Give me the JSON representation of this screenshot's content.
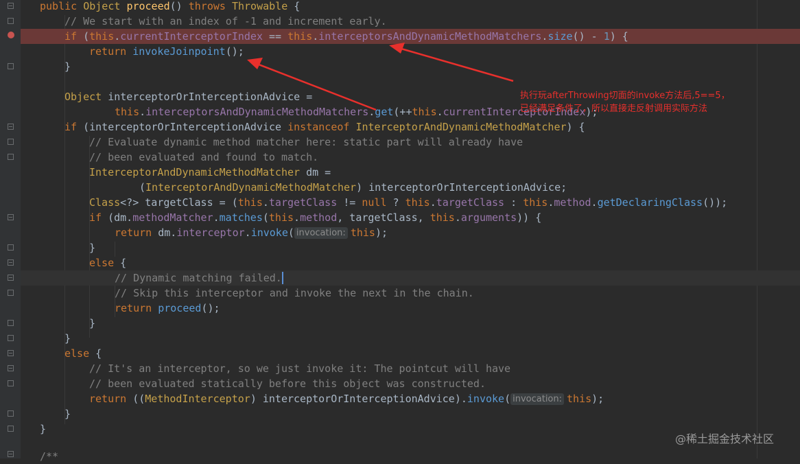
{
  "editor": {
    "lines": {
      "l1_kw1": "public ",
      "l1_type": "Object ",
      "l1_method": "proceed",
      "l1_paren": "() ",
      "l1_throws": "throws ",
      "l1_exc": "Throwable",
      "l1_brace": " {",
      "l2": "// We start with an index of -1 and increment early.",
      "l3_if": "if ",
      "l3_p1": "(",
      "l3_this1": "this",
      "l3_dot1": ".",
      "l3_f1": "currentInterceptorIndex",
      "l3_eq": " == ",
      "l3_this2": "this",
      "l3_dot2": ".",
      "l3_f2": "interceptorsAndDynamicMethodMatchers",
      "l3_dot3": ".",
      "l3_size": "size",
      "l3_rest1": "() - ",
      "l3_one": "1",
      "l3_rest2": ") {",
      "l4_ret": "return ",
      "l4_call": "invokeJoinpoint",
      "l4_rest": "();",
      "l5": "}",
      "l7_type": "Object ",
      "l7_rest": "interceptorOrInterceptionAdvice =",
      "l8_this1": "this",
      "l8_dot": ".",
      "l8_field": "interceptorsAndDynamicMethodMatchers",
      "l8_dot2": ".",
      "l8_get": "get",
      "l8_p": "(++",
      "l8_this2": "this",
      "l8_dot3": ".",
      "l8_f2": "currentInterceptorIndex",
      "l8_end": ");",
      "l9_if": "if ",
      "l9_mid": "(interceptorOrInterceptionAdvice ",
      "l9_inst": "instanceof ",
      "l9_type": "InterceptorAndDynamicMethodMatcher",
      "l9_end": ") {",
      "l10": "// Evaluate dynamic method matcher here: static part will already have",
      "l11": "// been evaluated and found to match.",
      "l12_type": "InterceptorAndDynamicMethodMatcher",
      "l12_rest": " dm =",
      "l13_p": "(",
      "l13_type": "InterceptorAndDynamicMethodMatcher",
      "l13_rest": ") interceptorOrInterceptionAdvice;",
      "l14_type": "Class",
      "l14_a": "<?> targetClass = (",
      "l14_this1": "this",
      "l14_d1": ".",
      "l14_f1": "targetClass",
      "l14_ne": " != ",
      "l14_null": "null",
      "l14_q": " ? ",
      "l14_this2": "this",
      "l14_d2": ".",
      "l14_f2": "targetClass",
      "l14_c": " : ",
      "l14_this3": "this",
      "l14_d3": ".",
      "l14_f3": "method",
      "l14_d4": ".",
      "l14_m": "getDeclaringClass",
      "l14_end": "());",
      "l15_if": "if ",
      "l15_a": "(dm.",
      "l15_f1": "methodMatcher",
      "l15_d1": ".",
      "l15_m": "matches",
      "l15_b": "(",
      "l15_this1": "this",
      "l15_d2": ".",
      "l15_f2": "method",
      "l15_c": ", targetClass, ",
      "l15_this2": "this",
      "l15_d3": ".",
      "l15_f3": "arguments",
      "l15_end": ")) {",
      "l16_ret": "return ",
      "l16_a": "dm.",
      "l16_f": "interceptor",
      "l16_d": ".",
      "l16_m": "invoke",
      "l16_b": "(",
      "l16_hint": "invocation:",
      "l16_this": "this",
      "l16_end": ");",
      "l17": "}",
      "l18_else": "else ",
      "l18_brace": "{",
      "l19": "// Dynamic matching failed.",
      "l20": "// Skip this interceptor and invoke the next in the chain.",
      "l21_ret": "return ",
      "l21_m": "proceed",
      "l21_end": "();",
      "l22": "}",
      "l23": "}",
      "l24_else": "else ",
      "l24_brace": "{",
      "l25": "// It's an interceptor, so we just invoke it: The pointcut will have",
      "l26": "// been evaluated statically before this object was constructed.",
      "l27_ret": "return ",
      "l27_a": "((",
      "l27_type": "MethodInterceptor",
      "l27_b": ") interceptorOrInterceptionAdvice).",
      "l27_m": "invoke",
      "l27_c": "(",
      "l27_hint": "invocation:",
      "l27_this": "this",
      "l27_end": ");",
      "l28": "}",
      "l29": "}",
      "l31": "/**"
    }
  },
  "annotation": {
    "line1": "执行玩afterThrowing切面的invoke方法后,5==5，",
    "line2": "已经满足条件了，所以直接走反射调用实际方法"
  },
  "watermark": "@稀土掘金技术社区",
  "colors": {
    "background": "#2b2b2b",
    "breakpoint_line": "#6b3937",
    "annotation": "#e8302c",
    "keyword": "#cc7832",
    "comment": "#808080",
    "field": "#9876aa"
  }
}
